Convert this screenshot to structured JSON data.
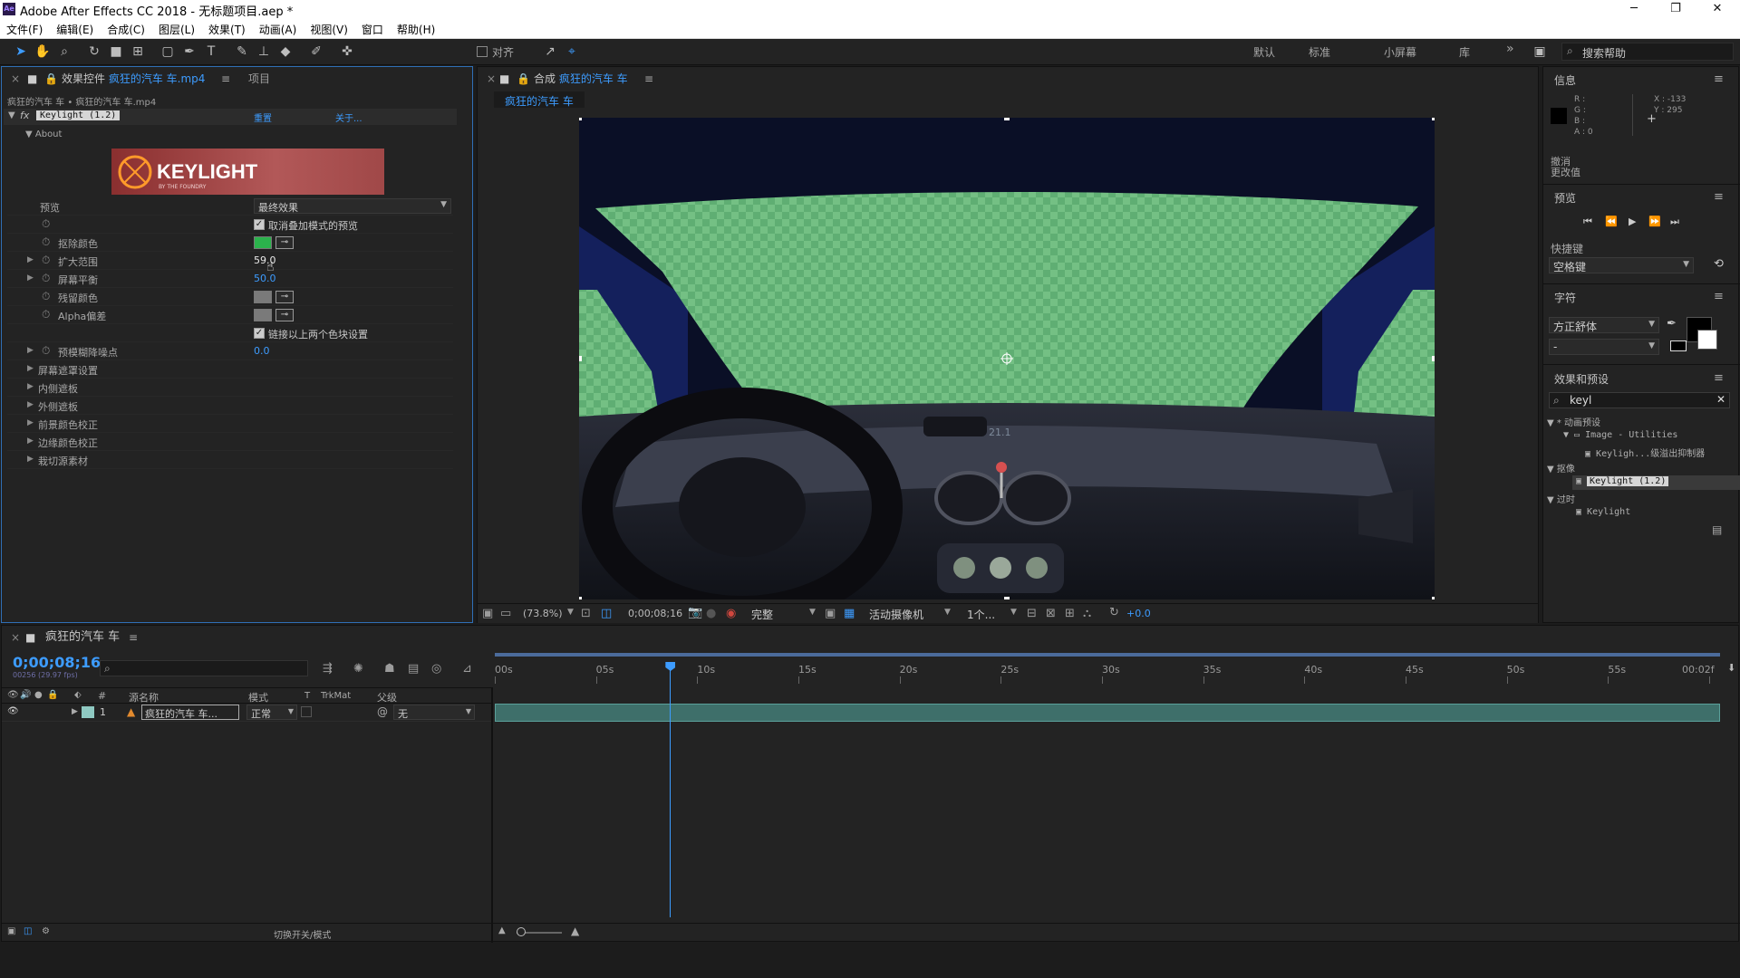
{
  "app": {
    "title": "Adobe After Effects CC 2018 - 无标题项目.aep *",
    "icon_text": "Ae"
  },
  "window_controls": {
    "minimize": "─",
    "maximize": "❐",
    "close": "✕"
  },
  "menu": [
    "文件(F)",
    "编辑(E)",
    "合成(C)",
    "图层(L)",
    "效果(T)",
    "动画(A)",
    "视图(V)",
    "窗口",
    "帮助(H)"
  ],
  "toolbar": {
    "align_label": "对齐",
    "workspaces": [
      "默认",
      "标准",
      "小屏幕",
      "库"
    ],
    "more": "»",
    "search_placeholder": "搜索帮助"
  },
  "effects_panel": {
    "tab_prefix": "效果控件",
    "tab_layer": "疯狂的汽车 车.mp4",
    "project_tab": "项目",
    "breadcrumb": "疯狂的汽车 车 • 疯狂的汽车 车.mp4",
    "effect_name": "Keylight (1.2)",
    "reset": "重置",
    "about": "关于...",
    "about_group": "About",
    "logo_text": "KEYLIGHT",
    "logo_sub": "BY THE FOUNDRY",
    "view_label": "预览",
    "view_value": "最终效果",
    "unpremultiply": "取消叠加模式的预览",
    "screen_colour": "抠除颜色",
    "screen_colour_hex": "#2bb24c",
    "screen_gain_label": "扩大范围",
    "screen_gain_value": "59.0",
    "screen_balance_label": "屏幕平衡",
    "screen_balance_value": "50.0",
    "despill_bias": "残留颜色",
    "alpha_bias": "Alpha偏差",
    "lock_biases": "链接以上两个色块设置",
    "screen_prematte_blur": "预模糊降噪点",
    "screen_prematte_blur_value": "0.0",
    "groups": [
      "屏幕遮罩设置",
      "内侧遮板",
      "外侧遮板",
      "前景颜色校正",
      "边缘颜色校正",
      "栽切源素材"
    ]
  },
  "comp_panel": {
    "tab_prefix": "合成",
    "tab_name": "疯狂的汽车 车",
    "comp_chip": "疯狂的汽车 车",
    "zoom": "(73.8%)",
    "timecode": "0;00;08;16",
    "resolution": "完整",
    "camera": "活动摄像机",
    "views": "1个...",
    "exposure": "+0.0",
    "dash_readout": "21.1"
  },
  "info_panel": {
    "title": "信息",
    "r": "R :",
    "g": "G :",
    "b": "B :",
    "a": "A : 0",
    "x": "X : -133",
    "y": "Y : 295",
    "undo": "撤消",
    "undo_detail": "更改值"
  },
  "preview_panel": {
    "title": "预览"
  },
  "shortcut_panel": {
    "title": "快捷键",
    "value": "空格键"
  },
  "character_panel": {
    "title": "字符",
    "font": "方正舒体",
    "style": "-"
  },
  "effects_presets": {
    "title": "效果和预设",
    "search": "keyl",
    "tree": [
      {
        "label": "* 动画预设",
        "depth": 0
      },
      {
        "label": "Image - Utilities",
        "depth": 1
      },
      {
        "label": "Keyligh...级溢出抑制器",
        "depth": 2
      },
      {
        "label": "抠像",
        "depth": 0
      },
      {
        "label": "Keylight (1.2)",
        "depth": 2
      },
      {
        "label": "过时",
        "depth": 0
      },
      {
        "label": "Keylight",
        "depth": 2
      }
    ]
  },
  "timeline": {
    "tab_name": "疯狂的汽车 车",
    "timecode": "0;00;08;16",
    "frames": "00256 (29.97 fps)",
    "search_placeholder": "",
    "col_num": "#",
    "col_source": "源名称",
    "col_mode": "模式",
    "col_t": "T",
    "col_trkmat": "TrkMat",
    "col_parent": "父级",
    "layer_num": "1",
    "layer_name": "疯狂的汽车 车...",
    "layer_mode": "正常",
    "layer_parent": "无",
    "ruler": [
      "00s",
      "05s",
      "10s",
      "15s",
      "20s",
      "25s",
      "30s",
      "35s",
      "40s",
      "45s",
      "50s",
      "55s",
      "00:02f"
    ],
    "toggle_modes": "切换开关/模式",
    "playhead_fraction": 0.143
  }
}
